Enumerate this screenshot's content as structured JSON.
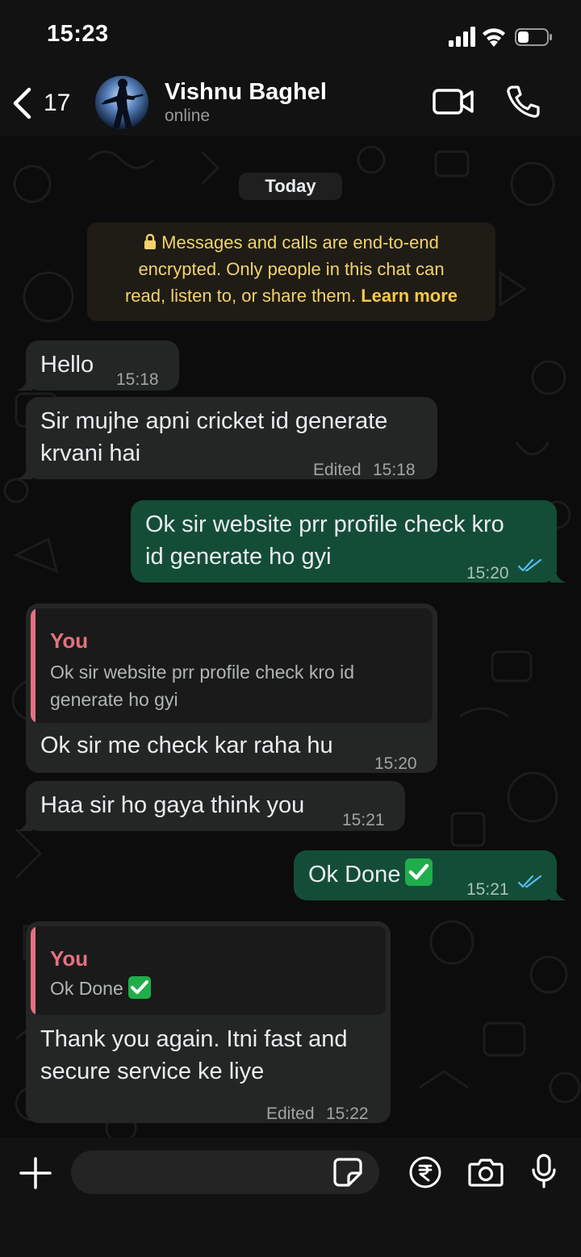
{
  "status_bar": {
    "time": "15:23"
  },
  "header": {
    "back_count": "17",
    "contact_name": "Vishnu Baghel",
    "contact_status": "online"
  },
  "chat": {
    "date_label": "Today",
    "encryption_notice": {
      "line1": "Messages and calls are end-to-end",
      "line2": "encrypted. Only people in this chat can",
      "line3": "read, listen to, or share them.",
      "learn_more": "Learn more"
    },
    "messages": [
      {
        "direction": "incoming",
        "lines": [
          "Hello"
        ],
        "time": "15:18"
      },
      {
        "direction": "incoming",
        "lines": [
          "Sir mujhe apni cricket id generate",
          "krvani hai"
        ],
        "edited": "Edited",
        "time": "15:18"
      },
      {
        "direction": "outgoing",
        "lines": [
          "Ok sir website prr profile check kro",
          "id generate ho gyi"
        ],
        "time": "15:20",
        "status": "read"
      },
      {
        "direction": "incoming",
        "reply_to": {
          "author": "You",
          "lines": [
            "Ok sir website prr profile check kro id",
            "generate ho gyi"
          ]
        },
        "lines": [
          "Ok sir me check kar raha hu"
        ],
        "time": "15:20"
      },
      {
        "direction": "incoming",
        "lines": [
          "Haa sir ho gaya think you"
        ],
        "time": "15:21"
      },
      {
        "direction": "outgoing",
        "lines": [
          "Ok Done"
        ],
        "emoji": "white-heavy-check-mark",
        "time": "15:21",
        "status": "read"
      },
      {
        "direction": "incoming",
        "reply_to": {
          "author": "You",
          "lines": [
            "Ok Done"
          ],
          "emoji": "white-heavy-check-mark"
        },
        "lines": [
          "Thank you again. Itni fast and",
          "secure service ke liye"
        ],
        "edited": "Edited",
        "time": "15:22"
      }
    ]
  },
  "input": {
    "placeholder": ""
  },
  "colors": {
    "incoming_bubble": "#242626",
    "outgoing_bubble": "#144d37",
    "quote_accent": "#e5717f",
    "read_ticks": "#53bdeb",
    "encryption_text": "#f5d26b"
  }
}
